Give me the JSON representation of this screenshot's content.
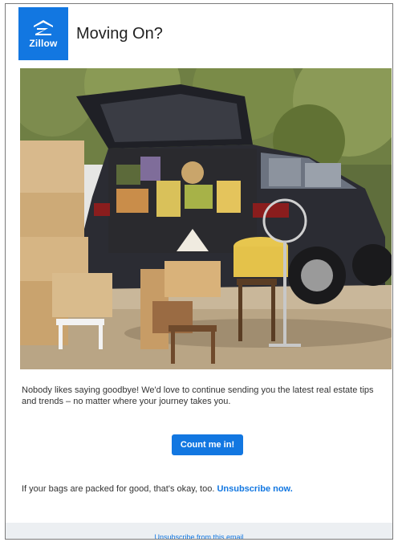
{
  "header": {
    "logo_text": "Zillow",
    "title": "Moving On?"
  },
  "hero": {
    "icon": "car-trunk-packed-photo"
  },
  "body": {
    "message": "Nobody likes saying goodbye! We'd love to continue sending you the latest real estate tips and trends – no matter where your journey takes you."
  },
  "cta": {
    "label": "Count me in!"
  },
  "closing": {
    "text": "If your bags are packed for good, that's okay, too.",
    "link_label": "Unsubscribe now."
  },
  "footer": {
    "unsubscribe_label": "Unsubscribe from this email"
  },
  "colors": {
    "brand_blue": "#1277e1",
    "footer_bg": "#eceff2"
  }
}
